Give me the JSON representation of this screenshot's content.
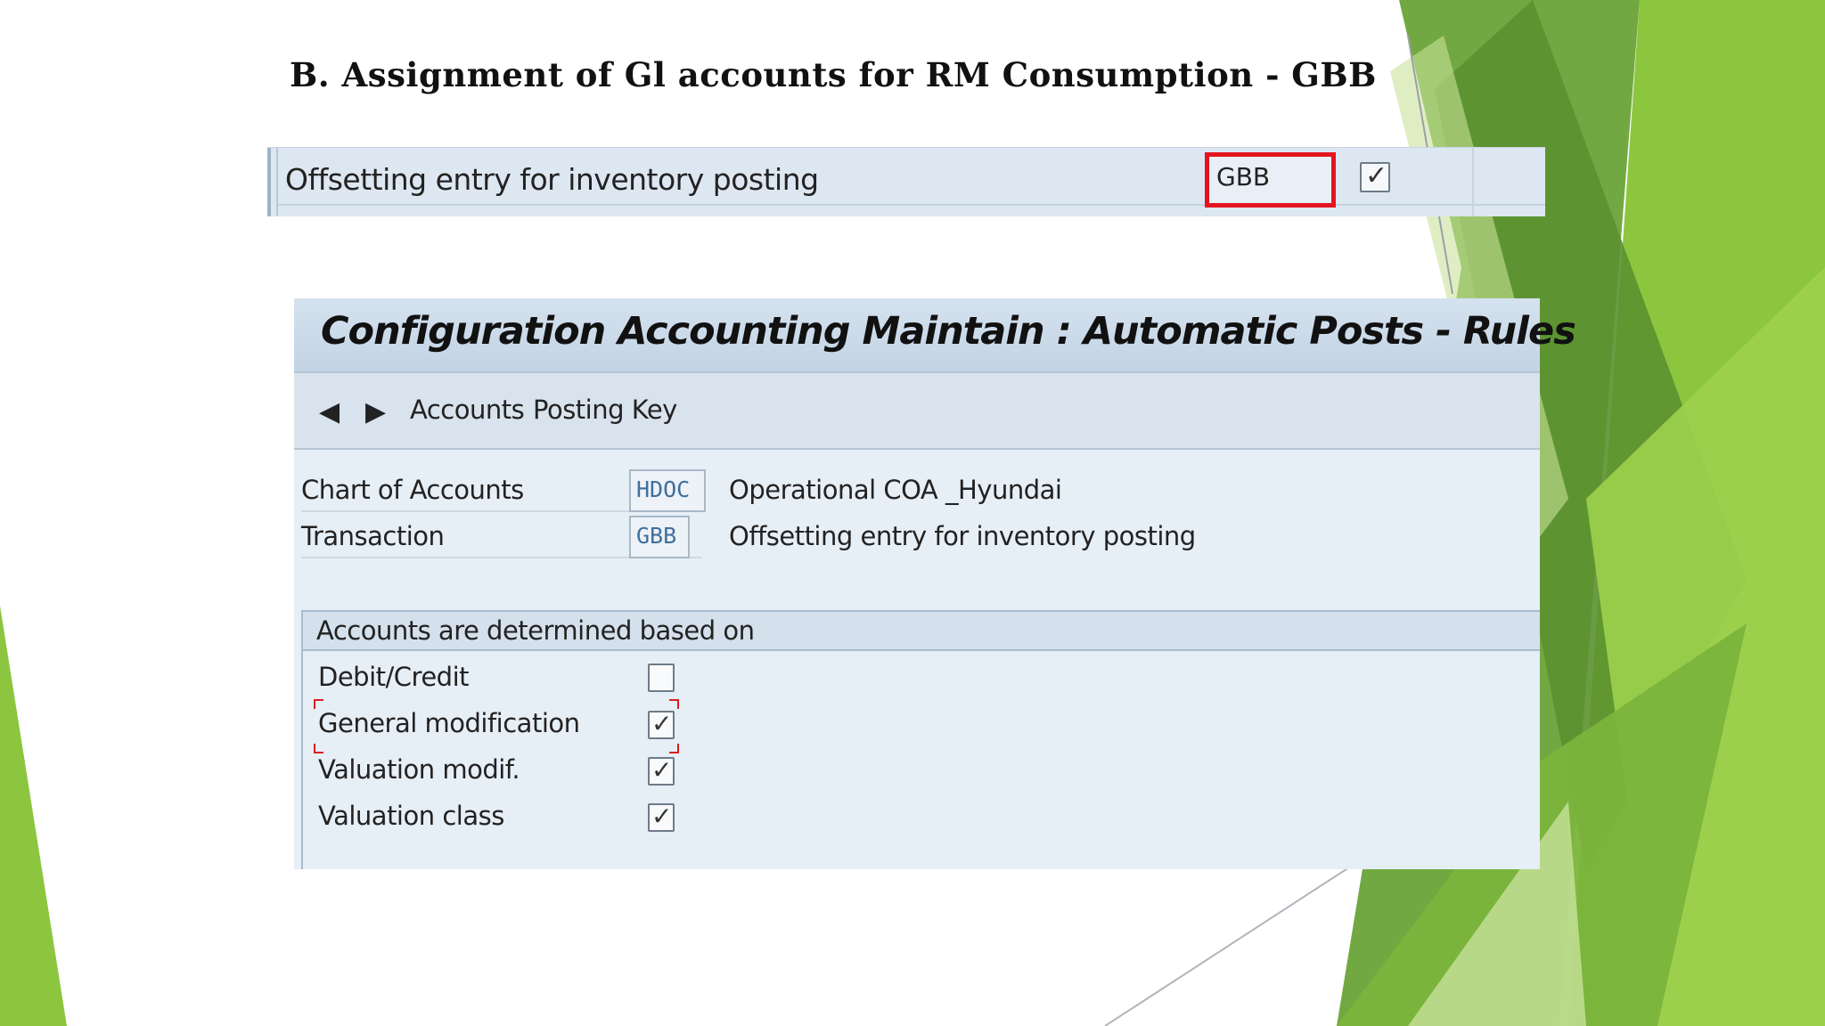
{
  "slide": {
    "title": "B. Assignment of Gl accounts for RM Consumption  - GBB",
    "colors": {
      "green_dark": "#5f9a2a",
      "green_mid": "#7fb539",
      "green_light": "#a6cf5a",
      "highlight_red": "#e4141e"
    }
  },
  "top_strip": {
    "description": "Offsetting entry for inventory posting",
    "code": "GBB",
    "checked": true
  },
  "panel": {
    "title": "Configuration Accounting Maintain : Automatic Posts - Rules",
    "toolbar": {
      "prev_icon": "arrow-left-icon",
      "next_icon": "arrow-right-icon",
      "accounts_label": "Accounts",
      "posting_key_label": "Posting Key"
    },
    "fields": [
      {
        "label": "Chart of Accounts",
        "value": "HDOC",
        "description": "Operational  COA _Hyundai"
      },
      {
        "label": "Transaction",
        "value": "GBB",
        "description": "Offsetting entry for inventory posting"
      }
    ],
    "group": {
      "title": "Accounts are determined based on",
      "options": [
        {
          "label": "Debit/Credit",
          "checked": false
        },
        {
          "label": "General modification",
          "checked": true
        },
        {
          "label": "Valuation modif.",
          "checked": true
        },
        {
          "label": "Valuation class",
          "checked": true
        }
      ]
    }
  }
}
